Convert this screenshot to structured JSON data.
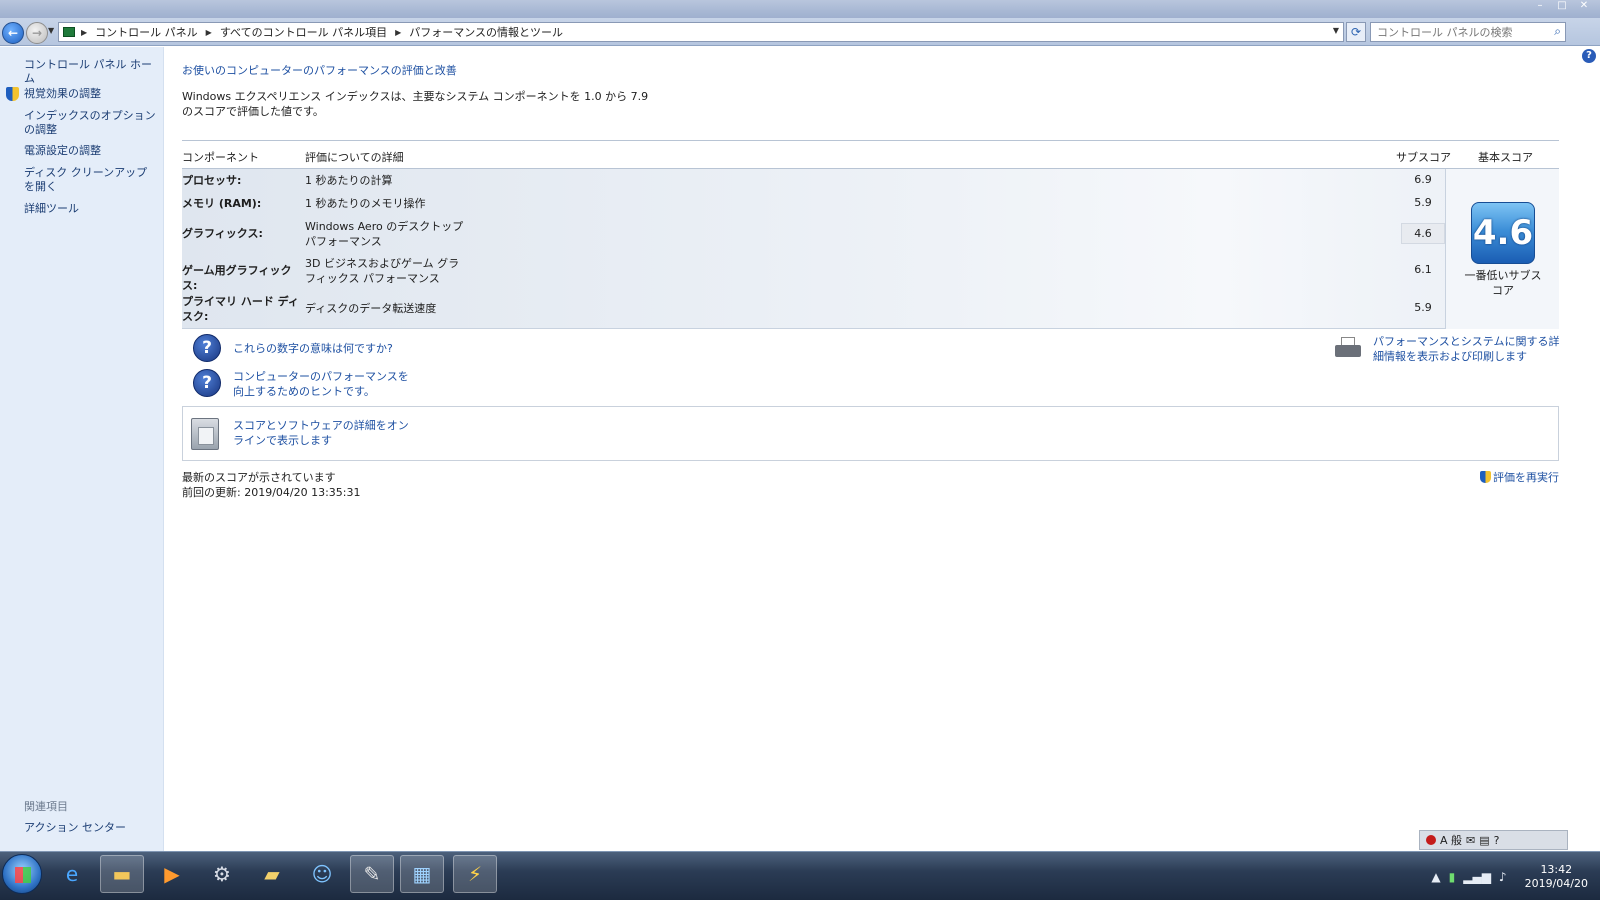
{
  "window": {
    "controls": [
      "–",
      "□",
      "✕"
    ]
  },
  "nav": {
    "breadcrumbs": [
      "コントロール パネル",
      "すべてのコントロール パネル項目",
      "パフォーマンスの情報とツール"
    ],
    "search_placeholder": "コントロール パネルの検索"
  },
  "sidebar": {
    "home": "コントロール パネル ホーム",
    "items": [
      {
        "label": "視覚効果の調整",
        "shield": true
      },
      {
        "label": "インデックスのオプションの調整",
        "shield": false
      },
      {
        "label": "電源設定の調整",
        "shield": false
      },
      {
        "label": "ディスク クリーンアップを開く",
        "shield": false
      },
      {
        "label": "詳細ツール",
        "shield": false
      }
    ],
    "related_heading": "関連項目",
    "related_link": "アクション センター"
  },
  "main": {
    "title": "お使いのコンピューターのパフォーマンスの評価と改善",
    "intro": "Windows エクスペリエンス インデックスは、主要なシステム コンポーネントを 1.0 から 7.9 のスコアで評価した値です。",
    "table": {
      "headers": {
        "component": "コンポーネント",
        "details": "評価についての詳細",
        "subscore": "サブスコア",
        "basescore": "基本スコア"
      },
      "rows": [
        {
          "component": "プロセッサ:",
          "details": "1 秒あたりの計算",
          "subscore": "6.9"
        },
        {
          "component": "メモリ (RAM):",
          "details": "1 秒あたりのメモリ操作",
          "subscore": "5.9"
        },
        {
          "component": "グラフィックス:",
          "details": "Windows Aero のデスクトップ パフォーマンス",
          "subscore": "4.6"
        },
        {
          "component": "ゲーム用グラフィックス:",
          "details": "3D ビジネスおよびゲーム グラフィックス パフォーマンス",
          "subscore": "6.1"
        },
        {
          "component": "プライマリ ハード ディスク:",
          "details": "ディスクのデータ転送速度",
          "subscore": "5.9"
        }
      ],
      "base_score": "4.6",
      "base_caption": "一番低いサブスコア"
    },
    "links": {
      "meaning": "これらの数字の意味は何ですか?",
      "tips": "コンピューターのパフォーマンスを向上するためのヒントです。",
      "print": "パフォーマンスとシステムに関する詳細情報を表示および印刷します",
      "online": "スコアとソフトウェアの詳細をオンラインで表示します"
    },
    "status": "最新のスコアが示されています",
    "last_update": "前回の更新: 2019/04/20 13:35:31",
    "rerun": "評価を再実行"
  },
  "langbar": {
    "mode": "A 般"
  },
  "taskbar": {
    "time": "13:42",
    "date": "2019/04/20"
  },
  "colors": {
    "link": "#1e50a2",
    "sidebar_bg": "#e4edf9",
    "badge": "#3d8fd8"
  }
}
